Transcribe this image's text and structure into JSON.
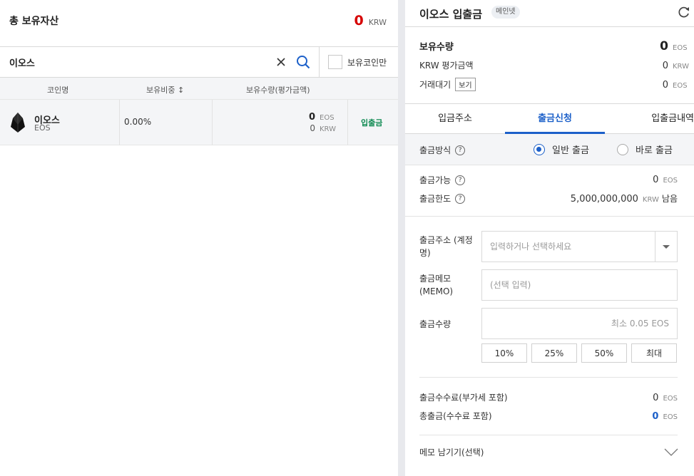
{
  "left": {
    "total": {
      "title": "총 보유자산",
      "value": "0",
      "unit": "KRW"
    },
    "search": {
      "value": "이오스",
      "placeholder": ""
    },
    "holding_only_label": "보유코인만",
    "columns": {
      "name": "코인명",
      "ratio": "보유비중 ↕",
      "qty": "보유수량(평가금액)"
    },
    "coin": {
      "name": "이오스",
      "symbol": "EOS",
      "ratio": "0.00%",
      "qty": "0",
      "qty_unit": "EOS",
      "eval": "0",
      "eval_unit": "KRW",
      "action": "입출금"
    }
  },
  "right": {
    "title": "이오스 입출금",
    "network_badge": "메인넷",
    "balance": {
      "held_label": "보유수량",
      "held_value": "0",
      "held_unit": "EOS",
      "krw_label": "KRW 평가금액",
      "krw_value": "0",
      "krw_unit": "KRW",
      "pending_label": "거래대기",
      "view_label": "보기",
      "pending_value": "0",
      "pending_unit": "EOS"
    },
    "tabs": [
      {
        "label": "입금주소"
      },
      {
        "label": "출금신청"
      },
      {
        "label": "입출금내역"
      }
    ],
    "method": {
      "label": "출금방식",
      "help": "?",
      "options": [
        {
          "label": "일반 출금"
        },
        {
          "label": "바로 출금"
        }
      ],
      "selected": "일반 출금"
    },
    "limits": {
      "available_label": "출금가능",
      "available_value": "0",
      "available_unit": "EOS",
      "limit_label": "출금한도",
      "limit_value": "5,000,000,000",
      "limit_unit": "KRW",
      "limit_suffix": "남음"
    },
    "form": {
      "address_label": "출금주소 (계정명)",
      "address_placeholder": "입력하거나 선택하세요",
      "memo_label": "출금메모 (MEMO)",
      "memo_placeholder": "(선택 입력)",
      "amount_label": "출금수량",
      "amount_placeholder": "최소 0.05 EOS",
      "percent_buttons": [
        "10%",
        "25%",
        "50%",
        "최대"
      ]
    },
    "fees": {
      "fee_label": "출금수수료(부가세 포함)",
      "fee_value": "0",
      "fee_unit": "EOS",
      "total_label": "총출금(수수료 포함)",
      "total_value": "0",
      "total_unit": "EOS"
    },
    "memo_toggle_label": "메모 남기기(선택)"
  },
  "colors": {
    "accent_blue": "#1c60c9",
    "negative_red": "#d60000",
    "deposit_green": "#0f8a52"
  }
}
